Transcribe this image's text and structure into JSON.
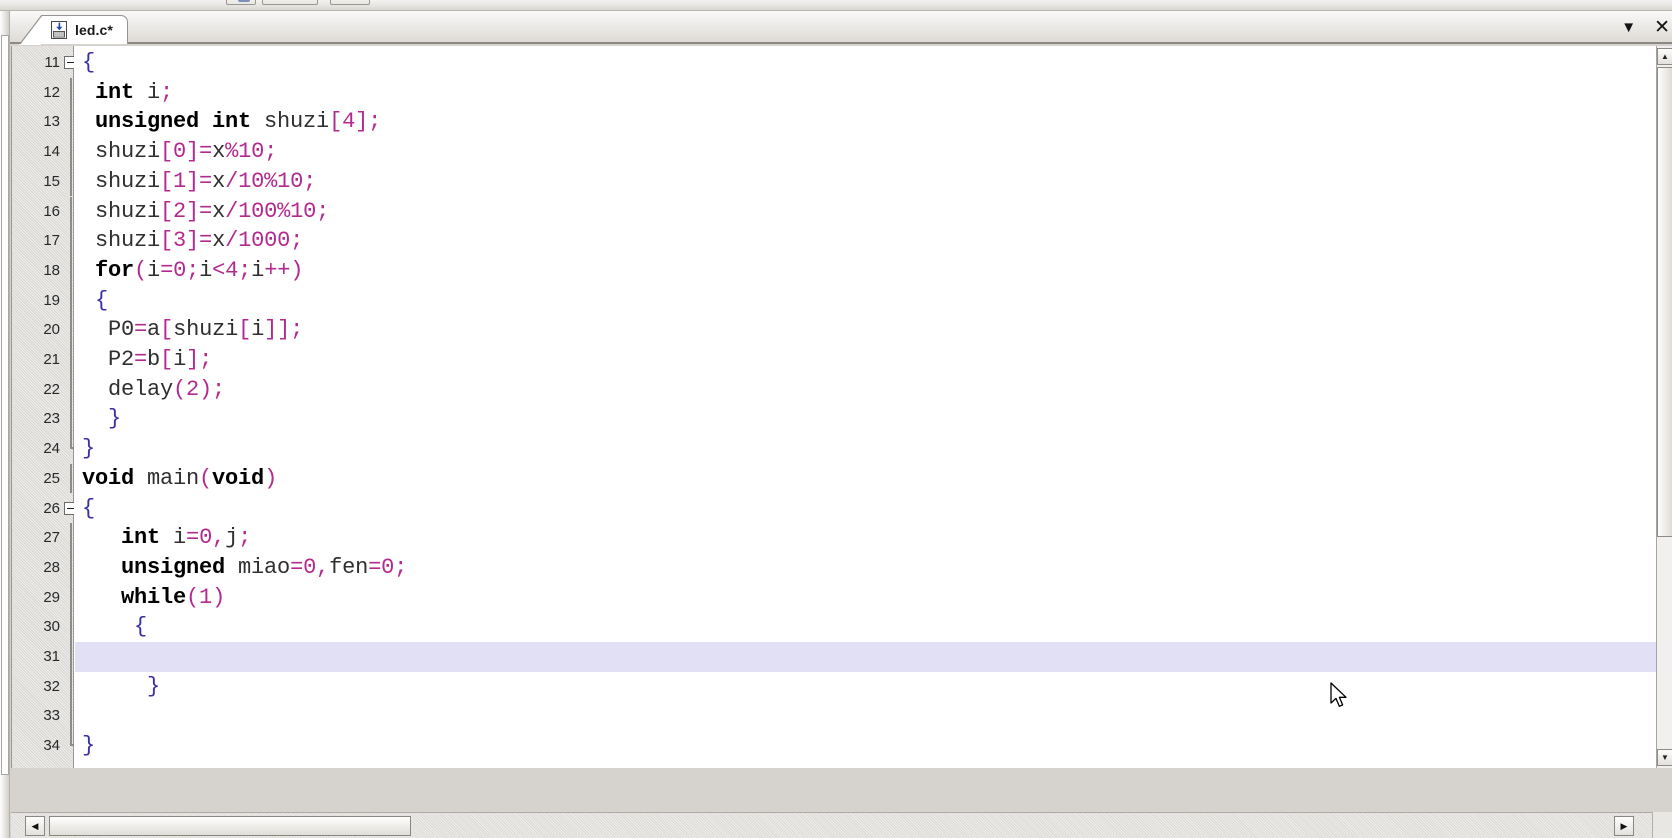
{
  "window": {
    "title": "led.c*",
    "accent_current_line": "#e2e0f5",
    "gutter_bg": "#d9d7d3"
  },
  "toolbar": {
    "buttons": [
      "tb-button-1",
      "tb-button-2",
      "tb-button-3"
    ]
  },
  "tabbar": {
    "tabs": [
      {
        "label": "led.c*",
        "icon": "c-source-file-icon",
        "modified": true,
        "active": true
      }
    ],
    "dropdown_glyph": "▼",
    "close_glyph": "✕",
    "dropdown_name": "tab-list-dropdown",
    "close_name": "close-document-button"
  },
  "scrollbars": {
    "vertical": {
      "up_glyph": "▲",
      "down_glyph": "▼"
    },
    "horizontal": {
      "left_glyph": "◀",
      "right_glyph": "▶"
    }
  },
  "editor": {
    "language": "c",
    "first_line": 11,
    "current_line": 31,
    "fold_start_lines": [
      11,
      26
    ],
    "fold_end_lines": [
      24,
      34
    ],
    "lines": [
      {
        "n": 11,
        "text": "{",
        "tokens": [
          {
            "t": "{",
            "c": "br"
          }
        ]
      },
      {
        "n": 12,
        "text": " int i;",
        "tokens": [
          {
            "t": " ",
            "c": "id"
          },
          {
            "t": "int",
            "c": "kw"
          },
          {
            "t": " i",
            "c": "id"
          },
          {
            "t": ";",
            "c": "pun"
          }
        ]
      },
      {
        "n": 13,
        "text": " unsigned int shuzi[4];",
        "tokens": [
          {
            "t": " ",
            "c": "id"
          },
          {
            "t": "unsigned int",
            "c": "kw"
          },
          {
            "t": " shuzi",
            "c": "id"
          },
          {
            "t": "[",
            "c": "pun"
          },
          {
            "t": "4",
            "c": "num"
          },
          {
            "t": "]",
            "c": "pun"
          },
          {
            "t": ";",
            "c": "pun"
          }
        ]
      },
      {
        "n": 14,
        "text": " shuzi[0]=x%10;",
        "tokens": [
          {
            "t": " shuzi",
            "c": "id"
          },
          {
            "t": "[",
            "c": "pun"
          },
          {
            "t": "0",
            "c": "num"
          },
          {
            "t": "]=",
            "c": "pun"
          },
          {
            "t": "x",
            "c": "id"
          },
          {
            "t": "%",
            "c": "pun"
          },
          {
            "t": "10",
            "c": "num"
          },
          {
            "t": ";",
            "c": "pun"
          }
        ]
      },
      {
        "n": 15,
        "text": " shuzi[1]=x/10%10;",
        "tokens": [
          {
            "t": " shuzi",
            "c": "id"
          },
          {
            "t": "[",
            "c": "pun"
          },
          {
            "t": "1",
            "c": "num"
          },
          {
            "t": "]=",
            "c": "pun"
          },
          {
            "t": "x",
            "c": "id"
          },
          {
            "t": "/",
            "c": "pun"
          },
          {
            "t": "10",
            "c": "num"
          },
          {
            "t": "%",
            "c": "pun"
          },
          {
            "t": "10",
            "c": "num"
          },
          {
            "t": ";",
            "c": "pun"
          }
        ]
      },
      {
        "n": 16,
        "text": " shuzi[2]=x/100%10;",
        "tokens": [
          {
            "t": " shuzi",
            "c": "id"
          },
          {
            "t": "[",
            "c": "pun"
          },
          {
            "t": "2",
            "c": "num"
          },
          {
            "t": "]=",
            "c": "pun"
          },
          {
            "t": "x",
            "c": "id"
          },
          {
            "t": "/",
            "c": "pun"
          },
          {
            "t": "100",
            "c": "num"
          },
          {
            "t": "%",
            "c": "pun"
          },
          {
            "t": "10",
            "c": "num"
          },
          {
            "t": ";",
            "c": "pun"
          }
        ]
      },
      {
        "n": 17,
        "text": " shuzi[3]=x/1000;",
        "tokens": [
          {
            "t": " shuzi",
            "c": "id"
          },
          {
            "t": "[",
            "c": "pun"
          },
          {
            "t": "3",
            "c": "num"
          },
          {
            "t": "]=",
            "c": "pun"
          },
          {
            "t": "x",
            "c": "id"
          },
          {
            "t": "/",
            "c": "pun"
          },
          {
            "t": "1000",
            "c": "num"
          },
          {
            "t": ";",
            "c": "pun"
          }
        ]
      },
      {
        "n": 18,
        "text": " for(i=0;i<4;i++)",
        "tokens": [
          {
            "t": " ",
            "c": "id"
          },
          {
            "t": "for",
            "c": "kw"
          },
          {
            "t": "(",
            "c": "pun"
          },
          {
            "t": "i",
            "c": "id"
          },
          {
            "t": "=",
            "c": "pun"
          },
          {
            "t": "0",
            "c": "num"
          },
          {
            "t": ";",
            "c": "pun"
          },
          {
            "t": "i",
            "c": "id"
          },
          {
            "t": "<",
            "c": "pun"
          },
          {
            "t": "4",
            "c": "num"
          },
          {
            "t": ";",
            "c": "pun"
          },
          {
            "t": "i",
            "c": "id"
          },
          {
            "t": "++",
            "c": "pun"
          },
          {
            "t": ")",
            "c": "pun"
          }
        ]
      },
      {
        "n": 19,
        "text": " {",
        "tokens": [
          {
            "t": " ",
            "c": "id"
          },
          {
            "t": "{",
            "c": "br"
          }
        ]
      },
      {
        "n": 20,
        "text": "  P0=a[shuzi[i]];",
        "tokens": [
          {
            "t": "  P0",
            "c": "id"
          },
          {
            "t": "=",
            "c": "pun"
          },
          {
            "t": "a",
            "c": "id"
          },
          {
            "t": "[",
            "c": "pun"
          },
          {
            "t": "shuzi",
            "c": "id"
          },
          {
            "t": "[",
            "c": "pun"
          },
          {
            "t": "i",
            "c": "id"
          },
          {
            "t": "]];",
            "c": "pun"
          }
        ]
      },
      {
        "n": 21,
        "text": "  P2=b[i];",
        "tokens": [
          {
            "t": "  P2",
            "c": "id"
          },
          {
            "t": "=",
            "c": "pun"
          },
          {
            "t": "b",
            "c": "id"
          },
          {
            "t": "[",
            "c": "pun"
          },
          {
            "t": "i",
            "c": "id"
          },
          {
            "t": "];",
            "c": "pun"
          }
        ]
      },
      {
        "n": 22,
        "text": "  delay(2);",
        "tokens": [
          {
            "t": "  delay",
            "c": "id"
          },
          {
            "t": "(",
            "c": "pun"
          },
          {
            "t": "2",
            "c": "num"
          },
          {
            "t": ");",
            "c": "pun"
          }
        ]
      },
      {
        "n": 23,
        "text": "  }",
        "tokens": [
          {
            "t": "  ",
            "c": "id"
          },
          {
            "t": "}",
            "c": "br"
          }
        ]
      },
      {
        "n": 24,
        "text": "}",
        "tokens": [
          {
            "t": "}",
            "c": "br"
          }
        ]
      },
      {
        "n": 25,
        "text": "void main(void)",
        "tokens": [
          {
            "t": "void",
            "c": "kw"
          },
          {
            "t": " main",
            "c": "id"
          },
          {
            "t": "(",
            "c": "pun"
          },
          {
            "t": "void",
            "c": "kw"
          },
          {
            "t": ")",
            "c": "pun"
          }
        ]
      },
      {
        "n": 26,
        "text": "{",
        "tokens": [
          {
            "t": "{",
            "c": "br"
          }
        ]
      },
      {
        "n": 27,
        "text": "   int i=0,j;",
        "tokens": [
          {
            "t": "   ",
            "c": "id"
          },
          {
            "t": "int",
            "c": "kw"
          },
          {
            "t": " i",
            "c": "id"
          },
          {
            "t": "=",
            "c": "pun"
          },
          {
            "t": "0",
            "c": "num"
          },
          {
            "t": ",",
            "c": "pun"
          },
          {
            "t": "j",
            "c": "id"
          },
          {
            "t": ";",
            "c": "pun"
          }
        ]
      },
      {
        "n": 28,
        "text": "   unsigned miao=0,fen=0;",
        "tokens": [
          {
            "t": "   ",
            "c": "id"
          },
          {
            "t": "unsigned",
            "c": "kw"
          },
          {
            "t": " miao",
            "c": "id"
          },
          {
            "t": "=",
            "c": "pun"
          },
          {
            "t": "0",
            "c": "num"
          },
          {
            "t": ",",
            "c": "pun"
          },
          {
            "t": "fen",
            "c": "id"
          },
          {
            "t": "=",
            "c": "pun"
          },
          {
            "t": "0",
            "c": "num"
          },
          {
            "t": ";",
            "c": "pun"
          }
        ]
      },
      {
        "n": 29,
        "text": "   while(1)",
        "tokens": [
          {
            "t": "   ",
            "c": "id"
          },
          {
            "t": "while",
            "c": "kw"
          },
          {
            "t": "(",
            "c": "pun"
          },
          {
            "t": "1",
            "c": "num"
          },
          {
            "t": ")",
            "c": "pun"
          }
        ]
      },
      {
        "n": 30,
        "text": "    {",
        "tokens": [
          {
            "t": "    ",
            "c": "id"
          },
          {
            "t": "{",
            "c": "br"
          }
        ]
      },
      {
        "n": 31,
        "text": "",
        "tokens": []
      },
      {
        "n": 32,
        "text": "     }",
        "tokens": [
          {
            "t": "     ",
            "c": "id"
          },
          {
            "t": "}",
            "c": "br"
          }
        ]
      },
      {
        "n": 33,
        "text": "",
        "tokens": []
      },
      {
        "n": 34,
        "text": "}",
        "tokens": [
          {
            "t": "}",
            "c": "br"
          }
        ]
      }
    ]
  }
}
